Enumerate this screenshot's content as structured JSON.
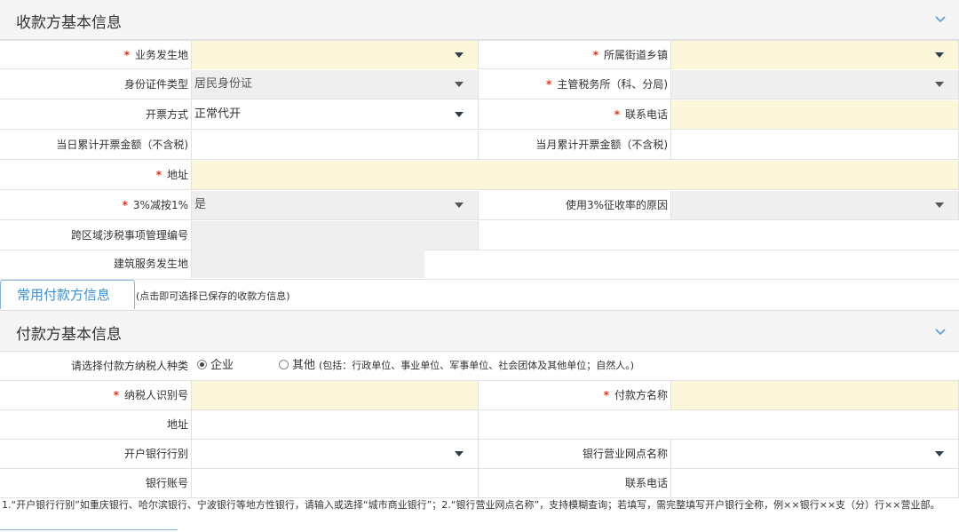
{
  "payee_section": {
    "title": "收款方基本信息",
    "fields": {
      "business_location": {
        "label": "业务发生地",
        "value": ""
      },
      "subdistrict": {
        "label": "所属街道乡镇",
        "value": ""
      },
      "id_type": {
        "label": "身份证件类型",
        "value": "居民身份证"
      },
      "tax_office": {
        "label": "主管税务所（科、分局)",
        "value": ""
      },
      "invoice_method": {
        "label": "开票方式",
        "value": "正常代开"
      },
      "phone": {
        "label": "联系电话",
        "value": ""
      },
      "day_total": {
        "label": "当日累计开票金额（不含税)",
        "value": ""
      },
      "month_total": {
        "label": "当月累计开票金额（不含税)",
        "value": ""
      },
      "address": {
        "label": "地址",
        "value": ""
      },
      "reduction": {
        "label": "3%减按1%",
        "value": "是"
      },
      "reason": {
        "label": "使用3%征收率的原因",
        "value": ""
      },
      "cross_region_no": {
        "label": "跨区域涉税事项管理编号",
        "value": ""
      },
      "construction_location": {
        "label": "建筑服务发生地",
        "value": ""
      }
    },
    "required_mark": "*"
  },
  "payer_button": {
    "label": "常用付款方信息",
    "hint": "(点击即可选择已保存的收款方信息)"
  },
  "payer_section": {
    "title": "付款方基本信息",
    "taxpayer_type": {
      "label": "请选择付款方纳税人种类",
      "options": [
        {
          "label": "企业",
          "selected": true
        },
        {
          "label": "其他",
          "selected": false,
          "note": "(包括：行政单位、事业单位、军事单位、社会团体及其他单位；自然人。)"
        }
      ]
    },
    "fields": {
      "taxpayer_id": {
        "label": "纳税人识别号",
        "value": ""
      },
      "payer_name": {
        "label": "付款方名称",
        "value": ""
      },
      "address": {
        "label": "地址",
        "value": ""
      },
      "bank_type": {
        "label": "开户银行行别",
        "value": ""
      },
      "bank_branch": {
        "label": "银行营业网点名称",
        "value": ""
      },
      "account": {
        "label": "银行账号",
        "value": ""
      },
      "phone": {
        "label": "联系电话",
        "value": ""
      }
    }
  },
  "note": "1.“开户银行行别”如重庆银行、哈尔滨银行、宁波银行等地方性银行，请输入或选择“城市商业银行”；2.“银行营业网点名称”，支持模糊查询；若填写，需完整填写开户银行全称，例××银行××支（分）行××营业部。",
  "colors": {
    "required": "#e0301e",
    "yellow_field": "#fdf7d9",
    "grey_field": "#efefef",
    "link_blue": "#3b8fd6"
  }
}
